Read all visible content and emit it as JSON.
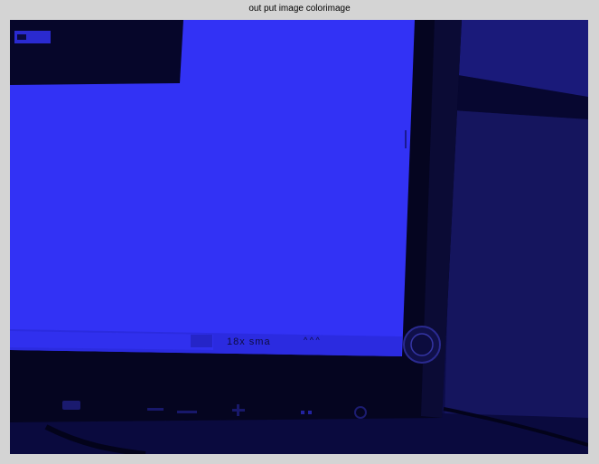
{
  "window": {
    "title": "out put image colorimage"
  },
  "image": {
    "description_tint": "#3030f6",
    "colors": {
      "screen": "#3131f5",
      "bezel": "#050520",
      "desk": "#0c0c44",
      "shadow": "#02020f",
      "background_right": "#14146a"
    },
    "screen_bottom_text": "18x sma",
    "screen_bottom_small": "^ ^ ^",
    "monitor_buttons": [
      "icon",
      "minus",
      "plus",
      "dots",
      "power"
    ]
  }
}
